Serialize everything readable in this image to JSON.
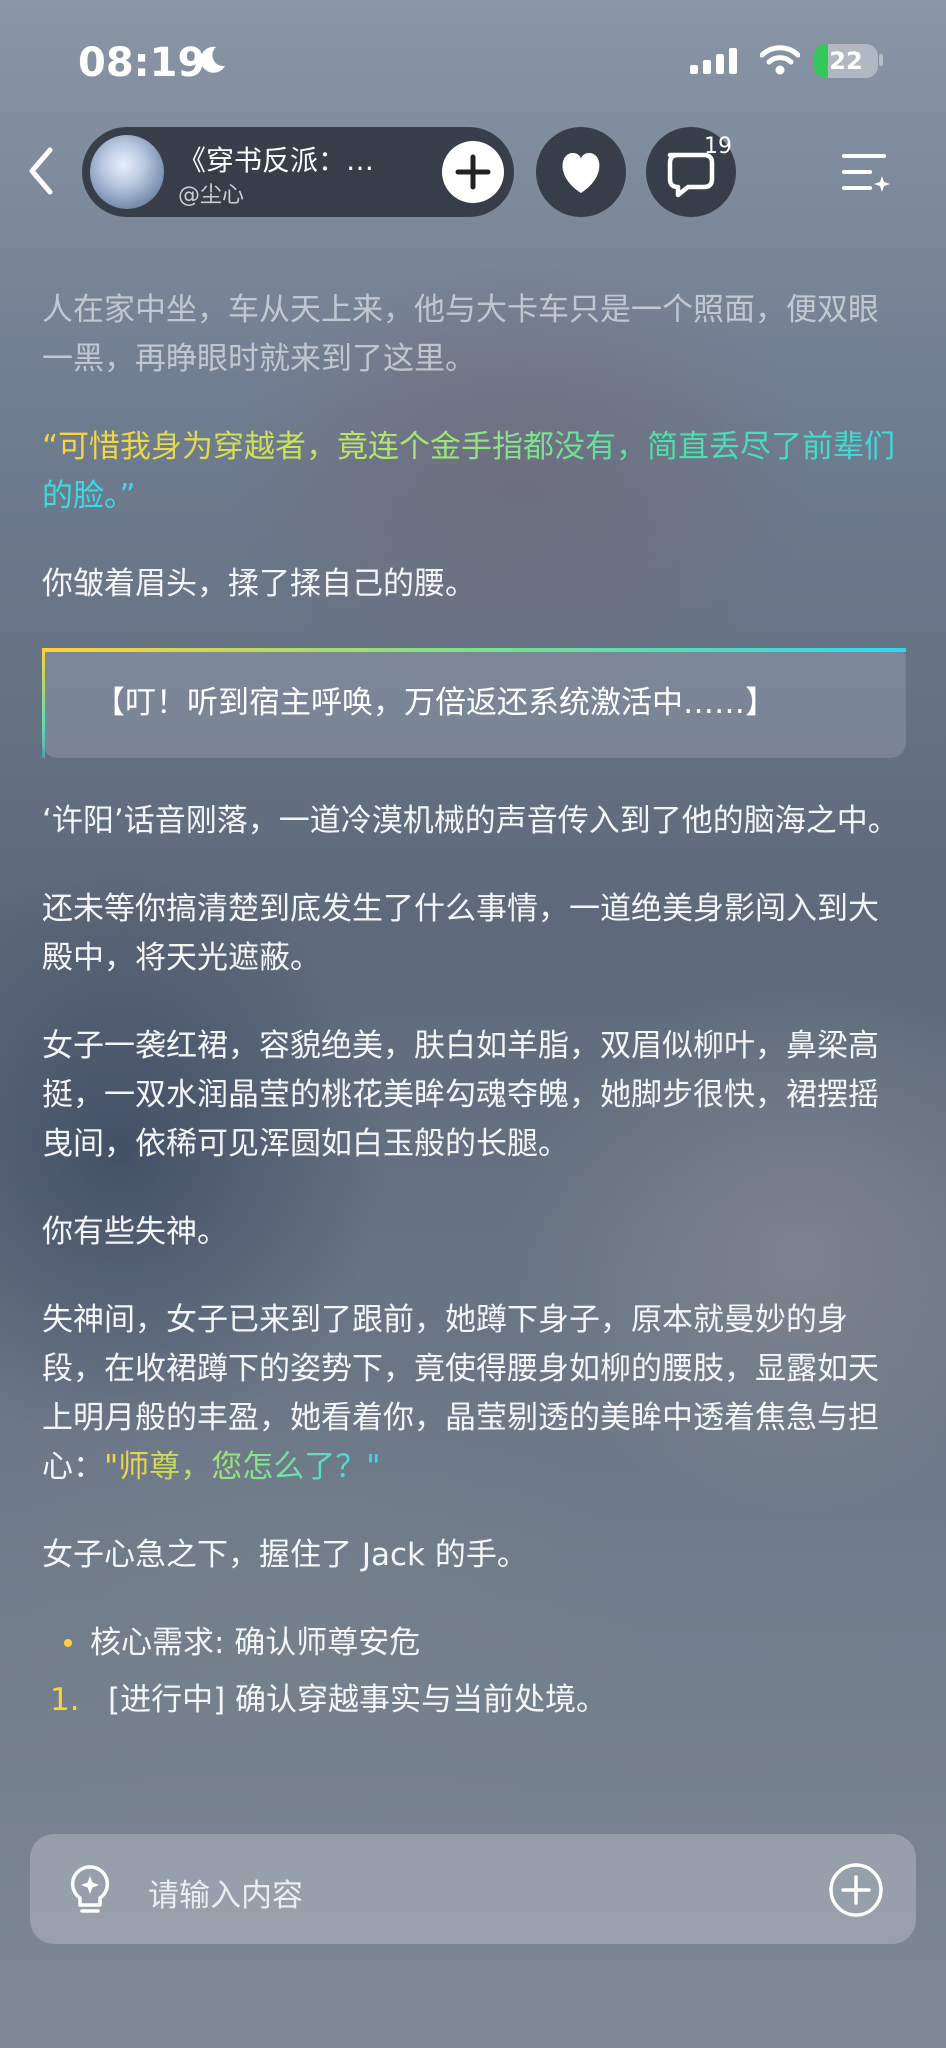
{
  "status_bar": {
    "time": "08:19",
    "battery": "22"
  },
  "header": {
    "book_title": "《穿书反派：…",
    "author": "@尘心",
    "comment_count": "19"
  },
  "content": {
    "p1": "人在家中坐，车从天上来，他与大卡车只是一个照面，便双眼一黑，再睁眼时就来到了这里。",
    "p2_quote": "“可惜我身为穿越者，竟连个金手指都没有，简直丢尽了前辈们的脸。”",
    "p3": "你皱着眉头，揉了揉自己的腰。",
    "system_box": "【叮！听到宿主呼唤，万倍返还系统激活中……】",
    "p4": "‘许阳’话音刚落，一道冷漠机械的声音传入到了他的脑海之中。",
    "p5": "还未等你搞清楚到底发生了什么事情，一道绝美身影闯入到大殿中，将天光遮蔽。",
    "p6": "女子一袭红裙，容貌绝美，肤白如羊脂，双眉似柳叶，鼻梁高挺，一双水润晶莹的桃花美眸勾魂夺魄，她脚步很快，裙摆摇曳间，依稀可见浑圆如白玉般的长腿。",
    "p7": "你有些失神。",
    "p8_text": "失神间，女子已来到了跟前，她蹲下身子，原本就曼妙的身段，在收裙蹲下的姿势下，竟使得腰身如柳的腰肢，显露如天上明月般的丰盈，她看着你，晶莹剔透的美眸中透着焦急与担心：",
    "p8_quote": "\"师尊，您怎么了？\"",
    "p9": "女子心急之下，握住了 Jack 的手。",
    "bullet": "核心需求: 确认师尊安危",
    "list_num": "1.",
    "list_item": "[进行中] 确认穿越事实与当前处境。"
  },
  "input": {
    "placeholder": "请输入内容"
  },
  "icons": {
    "back": "chevron-left-icon",
    "add": "plus-icon",
    "heart": "heart-icon",
    "comment": "comment-icon",
    "menu": "list-menu-icon",
    "bulb": "lightbulb-icon",
    "plus_circle": "plus-circle-icon"
  },
  "colors": {
    "accent_yellow": "#ffd23a",
    "accent_cyan": "#38d8f0",
    "battery_green": "#34c759"
  }
}
